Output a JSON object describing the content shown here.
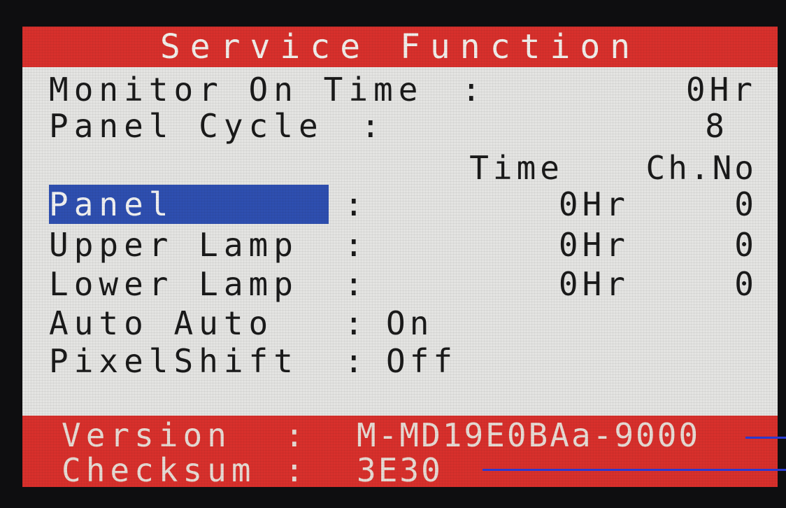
{
  "menu": {
    "title": "Service Function",
    "monitor_on_time": {
      "label": "Monitor On Time",
      "colon": ":",
      "value": "0Hr"
    },
    "panel_cycle": {
      "label": "Panel Cycle",
      "colon": ":",
      "value": "8"
    },
    "column_headers": {
      "time": "Time",
      "ch_no": "Ch.No"
    },
    "items": [
      {
        "label": "Panel",
        "colon": ":",
        "time": "0Hr",
        "ch_no": "0",
        "selected": true
      },
      {
        "label": "Upper Lamp",
        "colon": ":",
        "time": "0Hr",
        "ch_no": "0",
        "selected": false
      },
      {
        "label": "Lower Lamp",
        "colon": ":",
        "time": "0Hr",
        "ch_no": "0",
        "selected": false
      }
    ],
    "auto_auto": {
      "label": "Auto Auto",
      "colon": ":",
      "value": "On"
    },
    "pixel_shift": {
      "label": "PixelShift",
      "colon": ":",
      "value": "Off"
    }
  },
  "footer": {
    "version": {
      "label": "Version",
      "colon": ":",
      "value": "M-MD19E0BAa-9000"
    },
    "checksum": {
      "label": "Checksum",
      "colon": ":",
      "value": "3E30"
    }
  },
  "colors": {
    "title_bar": "#d8302c",
    "footer_bar": "#d8302c",
    "highlight": "#2e4fb0",
    "body_background": "#e4e4e2",
    "pointer_lines": "#2a3ad0"
  }
}
